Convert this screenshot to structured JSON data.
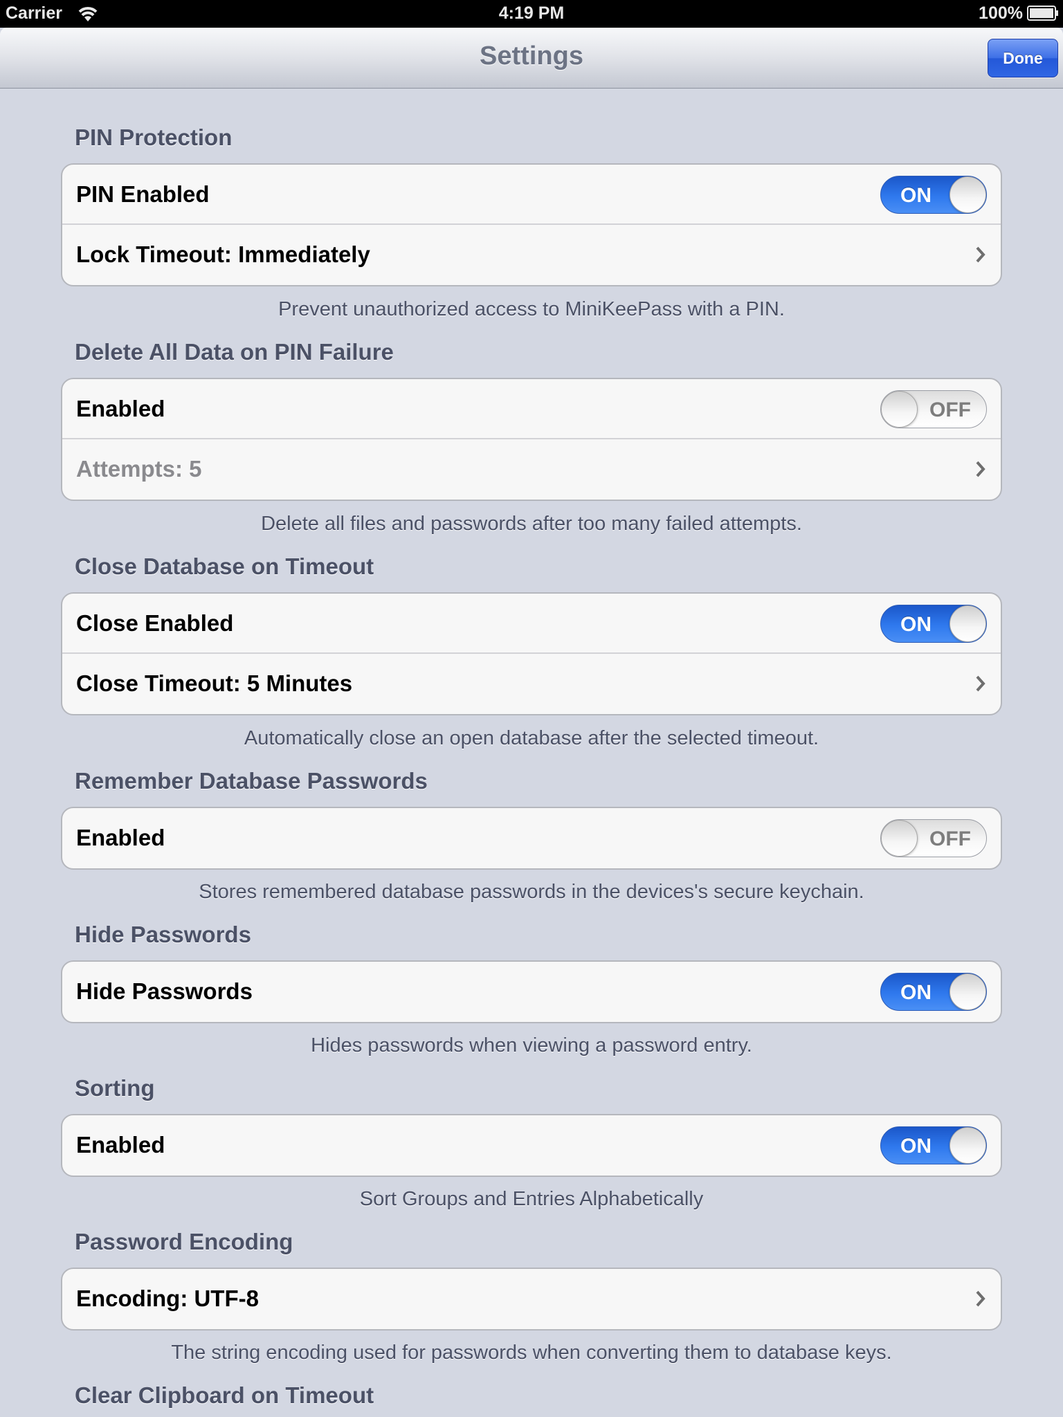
{
  "status_bar": {
    "carrier": "Carrier",
    "time": "4:19 PM",
    "battery": "100%"
  },
  "nav": {
    "title": "Settings",
    "done_label": "Done"
  },
  "sections": {
    "pin": {
      "header": "PIN Protection",
      "pin_enabled_label": "PIN Enabled",
      "pin_enabled_state": "ON",
      "lock_timeout_label": "Lock Timeout: Immediately",
      "footer": "Prevent unauthorized access to MiniKeePass with a PIN."
    },
    "delete_data": {
      "header": "Delete All Data on PIN Failure",
      "enabled_label": "Enabled",
      "enabled_state": "OFF",
      "attempts_label": "Attempts: 5",
      "footer": "Delete all files and passwords after too many failed attempts."
    },
    "close_db": {
      "header": "Close Database on Timeout",
      "close_enabled_label": "Close Enabled",
      "close_enabled_state": "ON",
      "close_timeout_label": "Close Timeout: 5 Minutes",
      "footer": "Automatically close an open database after the selected timeout."
    },
    "remember_pw": {
      "header": "Remember Database Passwords",
      "enabled_label": "Enabled",
      "enabled_state": "OFF",
      "footer": "Stores remembered database passwords in the devices's secure keychain."
    },
    "hide_pw": {
      "header": "Hide Passwords",
      "hide_label": "Hide Passwords",
      "hide_state": "ON",
      "footer": "Hides passwords when viewing a password entry."
    },
    "sorting": {
      "header": "Sorting",
      "enabled_label": "Enabled",
      "enabled_state": "ON",
      "footer": "Sort Groups and Entries Alphabetically"
    },
    "encoding": {
      "header": "Password Encoding",
      "encoding_label": "Encoding: UTF-8",
      "footer": "The string encoding used for passwords when converting them to database keys."
    },
    "clipboard": {
      "header": "Clear Clipboard on Timeout"
    }
  },
  "colors": {
    "background": "#d3d7e2",
    "switch_on": "#2f79ee",
    "done_button": "#3d6fe6",
    "header_text": "#4b5166"
  },
  "icons": {
    "wifi": "wifi-icon",
    "battery": "battery-icon",
    "chevron": "chevron-right-icon"
  }
}
